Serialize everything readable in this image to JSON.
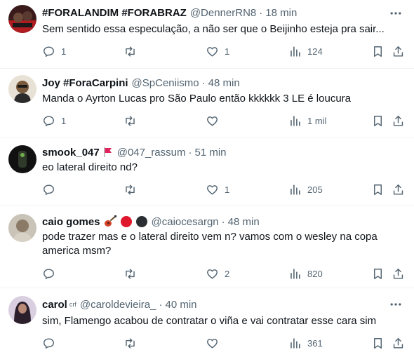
{
  "tweets": [
    {
      "name": "#FORALANDIM #FORABRAZ",
      "handle": "@DennerRN8",
      "dot": "·",
      "time": "18 min",
      "text": "Sem sentido essa especulação, a não ser que o Beijinho esteja pra sair...",
      "replies": "1",
      "retweets": "",
      "likes": "1",
      "views": "124"
    },
    {
      "name": "Joy #ForaCarpini",
      "handle": "@SpCeniismo",
      "dot": "·",
      "time": "48 min",
      "text": "Manda o Ayrton Lucas pro São Paulo então kkkkkk 3 LE é loucura",
      "replies": "1",
      "retweets": "",
      "likes": "",
      "views": "1 mil"
    },
    {
      "name": "smook_047",
      "handle": "@047_rassum",
      "dot": "·",
      "time": "51 min",
      "text": "eo lateral direito nd?",
      "replies": "",
      "retweets": "",
      "likes": "1",
      "views": "205"
    },
    {
      "name": "caio gomes",
      "handle": "@caiocesargn",
      "dot": "·",
      "time": "48 min",
      "text": "pode trazer mas e o lateral direito vem n? vamos com o wesley na copa america msm?",
      "replies": "",
      "retweets": "",
      "likes": "2",
      "views": "820"
    },
    {
      "name": "carol",
      "name_suffix": "crf",
      "handle": "@caroldevieira_",
      "dot": "·",
      "time": "40 min",
      "text": "sim, Flamengo acabou de contratar o viña e vai contratar esse cara sim",
      "replies": "",
      "retweets": "",
      "likes": "",
      "views": "361"
    }
  ],
  "icons": {
    "reply": "reply-icon",
    "retweet": "retweet-icon",
    "like": "heart-icon",
    "views": "views-icon",
    "bookmark": "bookmark-icon",
    "share": "share-icon",
    "more": "more-icon"
  },
  "colors": {
    "text": "#0f1419",
    "secondary": "#536471",
    "divider": "#eff3f4",
    "flag": "#e0245e",
    "red_circle": "#e0182d",
    "black_circle": "#292f33"
  }
}
